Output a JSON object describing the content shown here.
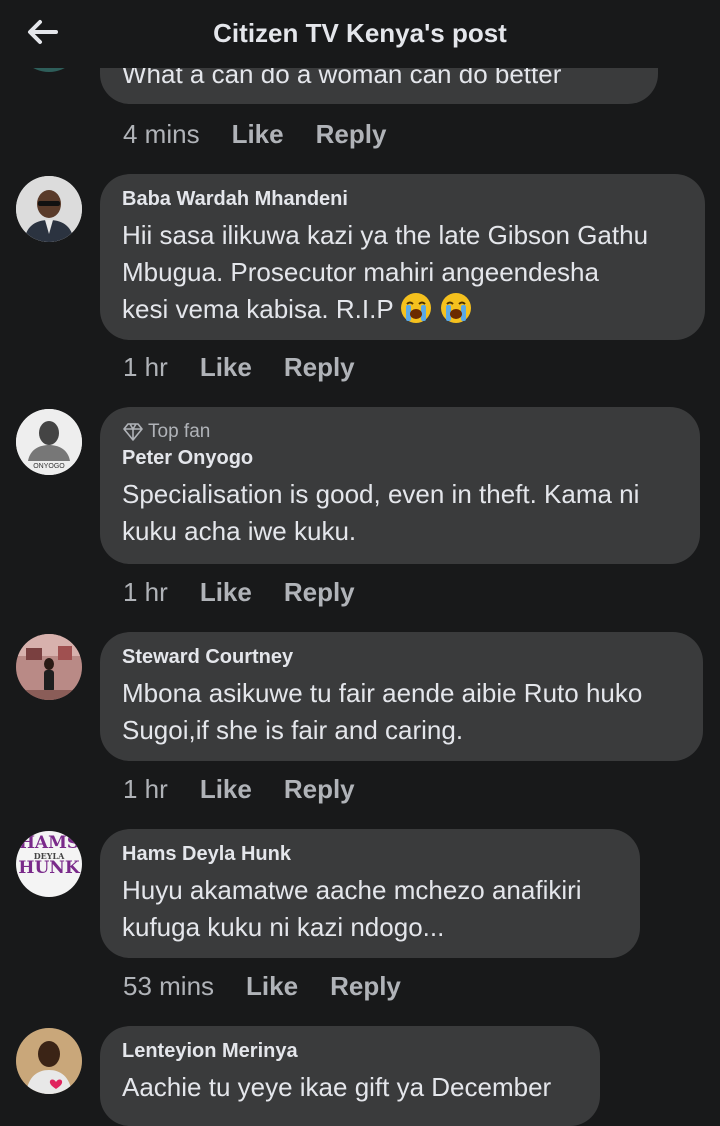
{
  "header": {
    "title": "Citizen TV Kenya's post",
    "back_icon": "arrow-left-icon"
  },
  "partial_comment": {
    "text": "What a can do a woman can do better",
    "time": "4 mins",
    "like": "Like",
    "reply": "Reply"
  },
  "comments": [
    {
      "name": "Baba Wardah Mhandeni",
      "lines": [
        "Hii sasa ilikuwa kazi ya the late Gibson Gathu",
        "Mbugua. Prosecutor mahiri angeendesha",
        "kesi vema kabisa. R.I.P"
      ],
      "emoji": "loudly-crying-face",
      "time": "1 hr",
      "like": "Like",
      "reply": "Reply"
    },
    {
      "badge": "Top fan",
      "badge_icon": "diamond-icon",
      "name": "Peter Onyogo",
      "avatar_text": "ONYOGO",
      "lines": [
        "Specialisation is good, even in theft. Kama ni",
        "kuku acha iwe kuku."
      ],
      "time": "1 hr",
      "like": "Like",
      "reply": "Reply"
    },
    {
      "name": "Steward Courtney",
      "lines": [
        "Mbona asikuwe tu fair aende aibie Ruto huko",
        "Sugoi,if she is fair and caring."
      ],
      "time": "1 hr",
      "like": "Like",
      "reply": "Reply"
    },
    {
      "name": "Hams Deyla Hunk",
      "avatar_text": [
        "HAMS",
        "DEYLA",
        "HUNK"
      ],
      "lines": [
        "Huyu akamatwe aache mchezo anafikiri",
        "kufuga kuku ni kazi ndogo..."
      ],
      "time": "53 mins",
      "like": "Like",
      "reply": "Reply"
    },
    {
      "name": "Lenteyion Merinya",
      "lines": [
        "Aachie tu yeye ikae gift ya December"
      ]
    }
  ],
  "colors": {
    "background": "#18191a",
    "bubble": "#3a3b3c",
    "text": "#e4e6eb",
    "muted": "#b0b3b8"
  }
}
